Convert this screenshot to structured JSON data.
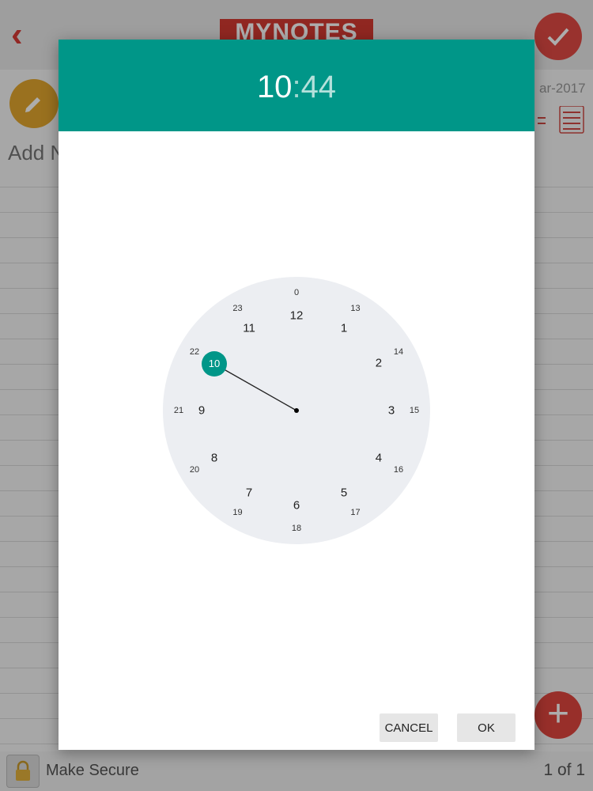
{
  "app": {
    "logo_text": "MYNOTES",
    "note_placeholder": "Add N",
    "date_fragment": "ar-2017",
    "make_secure_label": "Make Secure",
    "page_counter": "1 of 1",
    "accent_red": "#e0463f",
    "accent_orange": "#e3a72f"
  },
  "time_picker": {
    "hour": "10",
    "separator": ":",
    "minute": "44",
    "selected_hour": "10",
    "header_color": "#009688",
    "outer_hours": [
      "12",
      "1",
      "2",
      "3",
      "4",
      "5",
      "6",
      "7",
      "8",
      "9",
      "10",
      "11"
    ],
    "inner_hours": [
      "0",
      "13",
      "14",
      "15",
      "16",
      "17",
      "18",
      "19",
      "20",
      "21",
      "22",
      "23"
    ],
    "cancel_label": "CANCEL",
    "ok_label": "OK"
  }
}
